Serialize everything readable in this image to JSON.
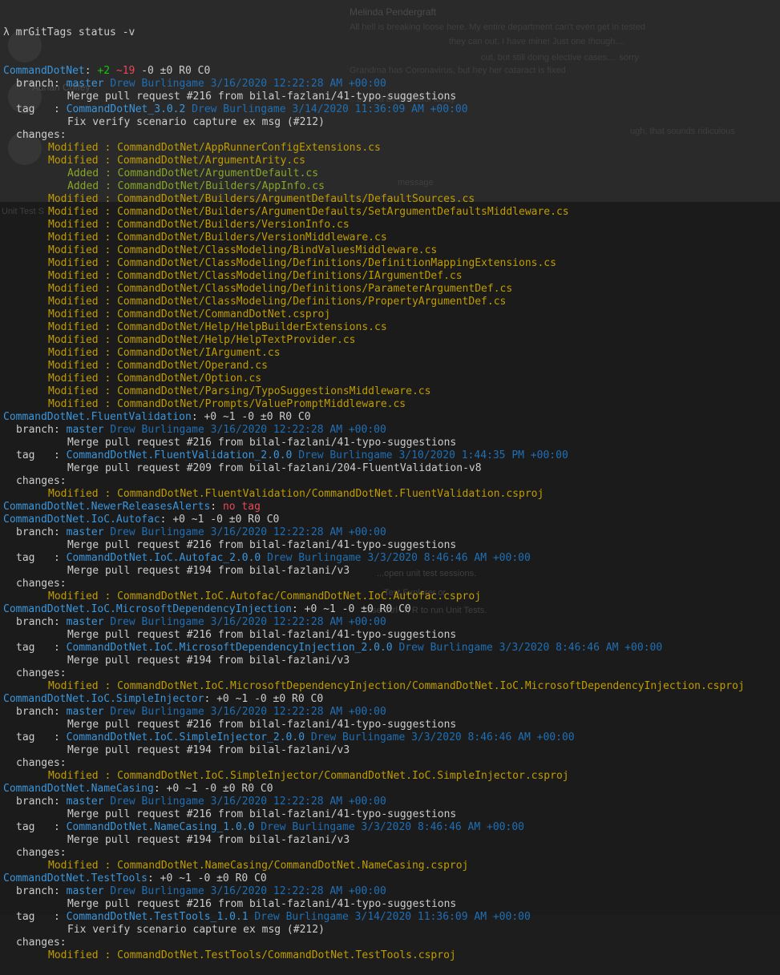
{
  "command": "λ mrGitTags status -v",
  "ghost_text": {
    "name1": "Melinda Pendergraft",
    "line1": "All hell is breaking loose here. My entire department can't even get in tested",
    "line2": "they can out. I have mine! Just one though....",
    "line3": "cut, but still doing elective cases.... sorry",
    "line4": "Grandma has Coronavirus, but hey her cataract is fixed",
    "name2": "Adrian Coffey",
    "line5": "...been a bit stressful today",
    "line6": "ugh, that sounds ridiculous",
    "line7": "message",
    "side_label": "Unit Test S",
    "panel1": "...open unit test sessions.",
    "panel2": "...Test Explorer or",
    "panel3": "use Ctrl+T, R to run Unit Tests."
  },
  "labels": {
    "branch": "branch: ",
    "tag": "tag   : ",
    "changes": "changes:",
    "modified": "Modified : ",
    "added": "Added : ",
    "no_tag": "no tag"
  },
  "repos": [
    {
      "name": "CommandDotNet",
      "stats_parts": [
        {
          "text": ": ",
          "style": "wht"
        },
        {
          "text": "+2",
          "style": "grn"
        },
        {
          "text": " ~19",
          "style": "red"
        },
        {
          "text": " -0 ±0 R0 C0",
          "style": "wht"
        }
      ],
      "branch": {
        "name": "master",
        "author": "Drew Burlingame",
        "date": "3/16/2020 12:22:28 AM +00:00",
        "message": "Merge pull request #216 from bilal-fazlani/41-typo-suggestions"
      },
      "tag": {
        "name": "CommandDotNet_3.0.2",
        "author": "Drew Burlingame",
        "date": "3/14/2020 11:36:09 AM +00:00",
        "message": "Fix verify scenario capture ex msg (#212)"
      },
      "changes": [
        {
          "type": "Modified",
          "path": "CommandDotNet/AppRunnerConfigExtensions.cs"
        },
        {
          "type": "Modified",
          "path": "CommandDotNet/ArgumentArity.cs"
        },
        {
          "type": "Added",
          "path": "CommandDotNet/ArgumentDefault.cs"
        },
        {
          "type": "Added",
          "path": "CommandDotNet/Builders/AppInfo.cs"
        },
        {
          "type": "Modified",
          "path": "CommandDotNet/Builders/ArgumentDefaults/DefaultSources.cs"
        },
        {
          "type": "Modified",
          "path": "CommandDotNet/Builders/ArgumentDefaults/SetArgumentDefaultsMiddleware.cs"
        },
        {
          "type": "Modified",
          "path": "CommandDotNet/Builders/VersionInfo.cs"
        },
        {
          "type": "Modified",
          "path": "CommandDotNet/Builders/VersionMiddleware.cs"
        },
        {
          "type": "Modified",
          "path": "CommandDotNet/ClassModeling/BindValuesMiddleware.cs"
        },
        {
          "type": "Modified",
          "path": "CommandDotNet/ClassModeling/Definitions/DefinitionMappingExtensions.cs"
        },
        {
          "type": "Modified",
          "path": "CommandDotNet/ClassModeling/Definitions/IArgumentDef.cs"
        },
        {
          "type": "Modified",
          "path": "CommandDotNet/ClassModeling/Definitions/ParameterArgumentDef.cs"
        },
        {
          "type": "Modified",
          "path": "CommandDotNet/ClassModeling/Definitions/PropertyArgumentDef.cs"
        },
        {
          "type": "Modified",
          "path": "CommandDotNet/CommandDotNet.csproj"
        },
        {
          "type": "Modified",
          "path": "CommandDotNet/Help/HelpBuilderExtensions.cs"
        },
        {
          "type": "Modified",
          "path": "CommandDotNet/Help/HelpTextProvider.cs"
        },
        {
          "type": "Modified",
          "path": "CommandDotNet/IArgument.cs"
        },
        {
          "type": "Modified",
          "path": "CommandDotNet/Operand.cs"
        },
        {
          "type": "Modified",
          "path": "CommandDotNet/Option.cs"
        },
        {
          "type": "Modified",
          "path": "CommandDotNet/Parsing/TypoSuggestionsMiddleware.cs"
        },
        {
          "type": "Modified",
          "path": "CommandDotNet/Prompts/ValuePromptMiddleware.cs"
        }
      ]
    },
    {
      "name": "CommandDotNet.FluentValidation",
      "stats_parts": [
        {
          "text": ": +0 ~1 -0 ±0 R0 C0",
          "style": "wht"
        }
      ],
      "branch": {
        "name": "master",
        "author": "Drew Burlingame",
        "date": "3/16/2020 12:22:28 AM +00:00",
        "message": "Merge pull request #216 from bilal-fazlani/41-typo-suggestions"
      },
      "tag": {
        "name": "CommandDotNet.FluentValidation_2.0.0",
        "author": "Drew Burlingame",
        "date": "3/10/2020 1:44:35 PM +00:00",
        "message": "Merge pull request #209 from bilal-fazlani/204-FluentValidation-v8"
      },
      "changes": [
        {
          "type": "Modified",
          "path": "CommandDotNet.FluentValidation/CommandDotNet.FluentValidation.csproj"
        }
      ]
    },
    {
      "name": "CommandDotNet.NewerReleasesAlerts",
      "stats_parts": [
        {
          "text": ": ",
          "style": "wht"
        }
      ],
      "no_tag": true
    },
    {
      "name": "CommandDotNet.IoC.Autofac",
      "stats_parts": [
        {
          "text": ": +0 ~1 -0 ±0 R0 C0",
          "style": "wht"
        }
      ],
      "branch": {
        "name": "master",
        "author": "Drew Burlingame",
        "date": "3/16/2020 12:22:28 AM +00:00",
        "message": "Merge pull request #216 from bilal-fazlani/41-typo-suggestions"
      },
      "tag": {
        "name": "CommandDotNet.IoC.Autofac_2.0.0",
        "author": "Drew Burlingame",
        "date": "3/3/2020 8:46:46 AM +00:00",
        "message": "Merge pull request #194 from bilal-fazlani/v3"
      },
      "changes": [
        {
          "type": "Modified",
          "path": "CommandDotNet.IoC.Autofac/CommandDotNet.IoC.Autofac.csproj"
        }
      ]
    },
    {
      "name": "CommandDotNet.IoC.MicrosoftDependencyInjection",
      "stats_parts": [
        {
          "text": ": +0 ~1 -0 ±0 R0 C0",
          "style": "wht"
        }
      ],
      "branch": {
        "name": "master",
        "author": "Drew Burlingame",
        "date": "3/16/2020 12:22:28 AM +00:00",
        "message": "Merge pull request #216 from bilal-fazlani/41-typo-suggestions"
      },
      "tag": {
        "name": "CommandDotNet.IoC.MicrosoftDependencyInjection_2.0.0",
        "author": "Drew Burlingame",
        "date": "3/3/2020 8:46:46 AM +00:00",
        "message": "Merge pull request #194 from bilal-fazlani/v3"
      },
      "changes": [
        {
          "type": "Modified",
          "path": "CommandDotNet.IoC.MicrosoftDependencyInjection/CommandDotNet.IoC.MicrosoftDependencyInjection.csproj"
        }
      ]
    },
    {
      "name": "CommandDotNet.IoC.SimpleInjector",
      "stats_parts": [
        {
          "text": ": +0 ~1 -0 ±0 R0 C0",
          "style": "wht"
        }
      ],
      "branch": {
        "name": "master",
        "author": "Drew Burlingame",
        "date": "3/16/2020 12:22:28 AM +00:00",
        "message": "Merge pull request #216 from bilal-fazlani/41-typo-suggestions"
      },
      "tag": {
        "name": "CommandDotNet.IoC.SimpleInjector_2.0.0",
        "author": "Drew Burlingame",
        "date": "3/3/2020 8:46:46 AM +00:00",
        "message": "Merge pull request #194 from bilal-fazlani/v3"
      },
      "changes": [
        {
          "type": "Modified",
          "path": "CommandDotNet.IoC.SimpleInjector/CommandDotNet.IoC.SimpleInjector.csproj"
        }
      ]
    },
    {
      "name": "CommandDotNet.NameCasing",
      "stats_parts": [
        {
          "text": ": +0 ~1 -0 ±0 R0 C0",
          "style": "wht"
        }
      ],
      "branch": {
        "name": "master",
        "author": "Drew Burlingame",
        "date": "3/16/2020 12:22:28 AM +00:00",
        "message": "Merge pull request #216 from bilal-fazlani/41-typo-suggestions"
      },
      "tag": {
        "name": "CommandDotNet.NameCasing_1.0.0",
        "author": "Drew Burlingame",
        "date": "3/3/2020 8:46:46 AM +00:00",
        "message": "Merge pull request #194 from bilal-fazlani/v3"
      },
      "changes": [
        {
          "type": "Modified",
          "path": "CommandDotNet.NameCasing/CommandDotNet.NameCasing.csproj"
        }
      ]
    },
    {
      "name": "CommandDotNet.TestTools",
      "stats_parts": [
        {
          "text": ": +0 ~1 -0 ±0 R0 C0",
          "style": "wht"
        }
      ],
      "branch": {
        "name": "master",
        "author": "Drew Burlingame",
        "date": "3/16/2020 12:22:28 AM +00:00",
        "message": "Merge pull request #216 from bilal-fazlani/41-typo-suggestions"
      },
      "tag": {
        "name": "CommandDotNet.TestTools_1.0.1",
        "author": "Drew Burlingame",
        "date": "3/14/2020 11:36:09 AM +00:00",
        "message": "Fix verify scenario capture ex msg (#212)"
      },
      "changes": [
        {
          "type": "Modified",
          "path": "CommandDotNet.TestTools/CommandDotNet.TestTools.csproj"
        }
      ]
    }
  ]
}
